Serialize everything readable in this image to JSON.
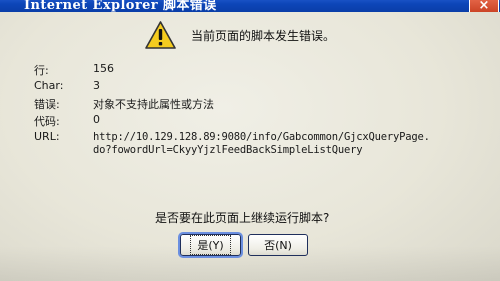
{
  "window": {
    "title": "Internet Explorer 脚本错误",
    "close_label": "×"
  },
  "dialog": {
    "message": "当前页面的脚本发生错误。",
    "fields": {
      "line_label": "行:",
      "line_value": "156",
      "char_label": "Char:",
      "char_value": "3",
      "error_label": "错误:",
      "error_value": "对象不支持此属性或方法",
      "code_label": "代码:",
      "code_value": "0",
      "url_label": "URL:",
      "url_value_line1": "http://10.129.128.89:9080/info/Gabcommon/GjcxQueryPage.",
      "url_value_line2": "do?fowordUrl=CkyyYjzlFeedBackSimpleListQuery"
    },
    "question": "是否要在此页面上继续运行脚本?"
  },
  "buttons": {
    "yes_label": "是(Y)",
    "no_label": "否(N)"
  },
  "icons": {
    "warning": "warning-icon"
  }
}
